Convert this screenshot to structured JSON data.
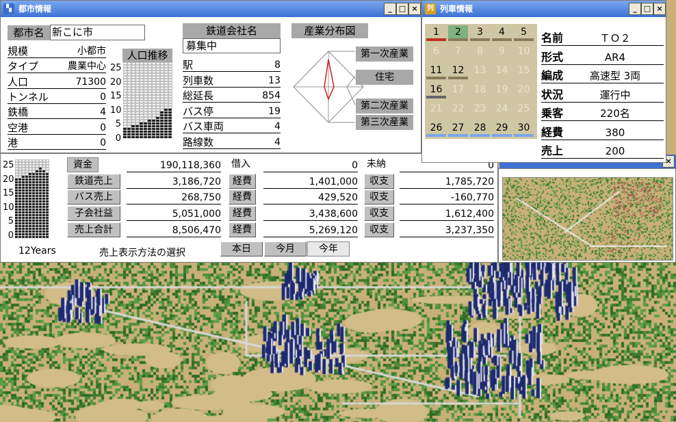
{
  "city_window": {
    "title": "都市情報",
    "city_name_label": "都市名",
    "city_name_value": "新こに市",
    "stats": [
      {
        "label": "規模",
        "value": "小都市"
      },
      {
        "label": "タイプ",
        "value": "農業中心"
      },
      {
        "label": "人口",
        "value": "71300"
      },
      {
        "label": "トンネル",
        "value": "0"
      },
      {
        "label": "鉄橋",
        "value": "4"
      },
      {
        "label": "空港",
        "value": "0"
      },
      {
        "label": "港",
        "value": "0"
      }
    ],
    "population_chart_label": "人口推移",
    "y_ticks": [
      "25",
      "20",
      "15",
      "10",
      "5",
      "0"
    ],
    "railway_label": "鉄道会社名",
    "railway_value": "募集中",
    "rail_stats": [
      {
        "label": "駅",
        "value": "8"
      },
      {
        "label": "列車数",
        "value": "13"
      },
      {
        "label": "総延長",
        "value": "854"
      },
      {
        "label": "バス停",
        "value": "19"
      },
      {
        "label": "バス車両",
        "value": "4"
      },
      {
        "label": "路線数",
        "value": "4"
      }
    ],
    "industry_label": "産業分布図",
    "industry_items": [
      "第一次産業",
      "住宅",
      "第二次産業",
      "第三次産業"
    ]
  },
  "finance_window": {
    "y_ticks": [
      "25",
      "20",
      "15",
      "10",
      "5",
      "0"
    ],
    "years_label": "12Years",
    "select_label": "売上表示方法の選択",
    "period_buttons": [
      "本日",
      "今月",
      "今年"
    ],
    "selected_period": "今年",
    "rows": [
      {
        "label": "資金",
        "v1": "190,118,360",
        "l2": "借入",
        "v2": "0",
        "l3": "未納",
        "v3": "0"
      },
      {
        "label": "鉄道売上",
        "v1": "3,186,720",
        "l2": "経費",
        "v2": "1,401,000",
        "l3": "収支",
        "v3": "1,785,720"
      },
      {
        "label": "バス売上",
        "v1": "268,750",
        "l2": "経費",
        "v2": "429,520",
        "l3": "収支",
        "v3": "-160,770"
      },
      {
        "label": "子会社益",
        "v1": "5,051,000",
        "l2": "経費",
        "v2": "3,438,600",
        "l3": "収支",
        "v3": "1,612,400"
      },
      {
        "label": "売上合計",
        "v1": "8,506,470",
        "l2": "経費",
        "v2": "5,269,120",
        "l3": "収支",
        "v3": "3,237,350"
      }
    ]
  },
  "train_window": {
    "title": "列車情報",
    "calendar_days": [
      "1",
      "2",
      "3",
      "4",
      "5",
      "6",
      "7",
      "8",
      "9",
      "10",
      "11",
      "12",
      "13",
      "14",
      "15",
      "16",
      "17",
      "18",
      "19",
      "20",
      "21",
      "22",
      "23",
      "24",
      "25",
      "26",
      "27",
      "28",
      "29",
      "30"
    ],
    "active_days": [
      1,
      2,
      3,
      4,
      5,
      11,
      12,
      16,
      26,
      27,
      28,
      29,
      30
    ],
    "highlight_day": 2,
    "info": [
      {
        "label": "名前",
        "value": "ＴＯ２"
      },
      {
        "label": "形式",
        "value": "AR4"
      },
      {
        "label": "編成",
        "value": "高速型 3両"
      },
      {
        "label": "状況",
        "value": "運行中"
      },
      {
        "label": "乗客",
        "value": "220名"
      },
      {
        "label": "経費",
        "value": "380"
      },
      {
        "label": "売上",
        "value": "200"
      }
    ]
  },
  "window_buttons": {
    "minimize": "_",
    "maximize": "□",
    "close": "×"
  },
  "colors": {
    "title_bar": "#3d72d4",
    "grass": "#4e8f3a",
    "sand": "#c8b078",
    "calendar_bg": "#cfc6a4",
    "calendar_highlight": "#7fb27f"
  }
}
